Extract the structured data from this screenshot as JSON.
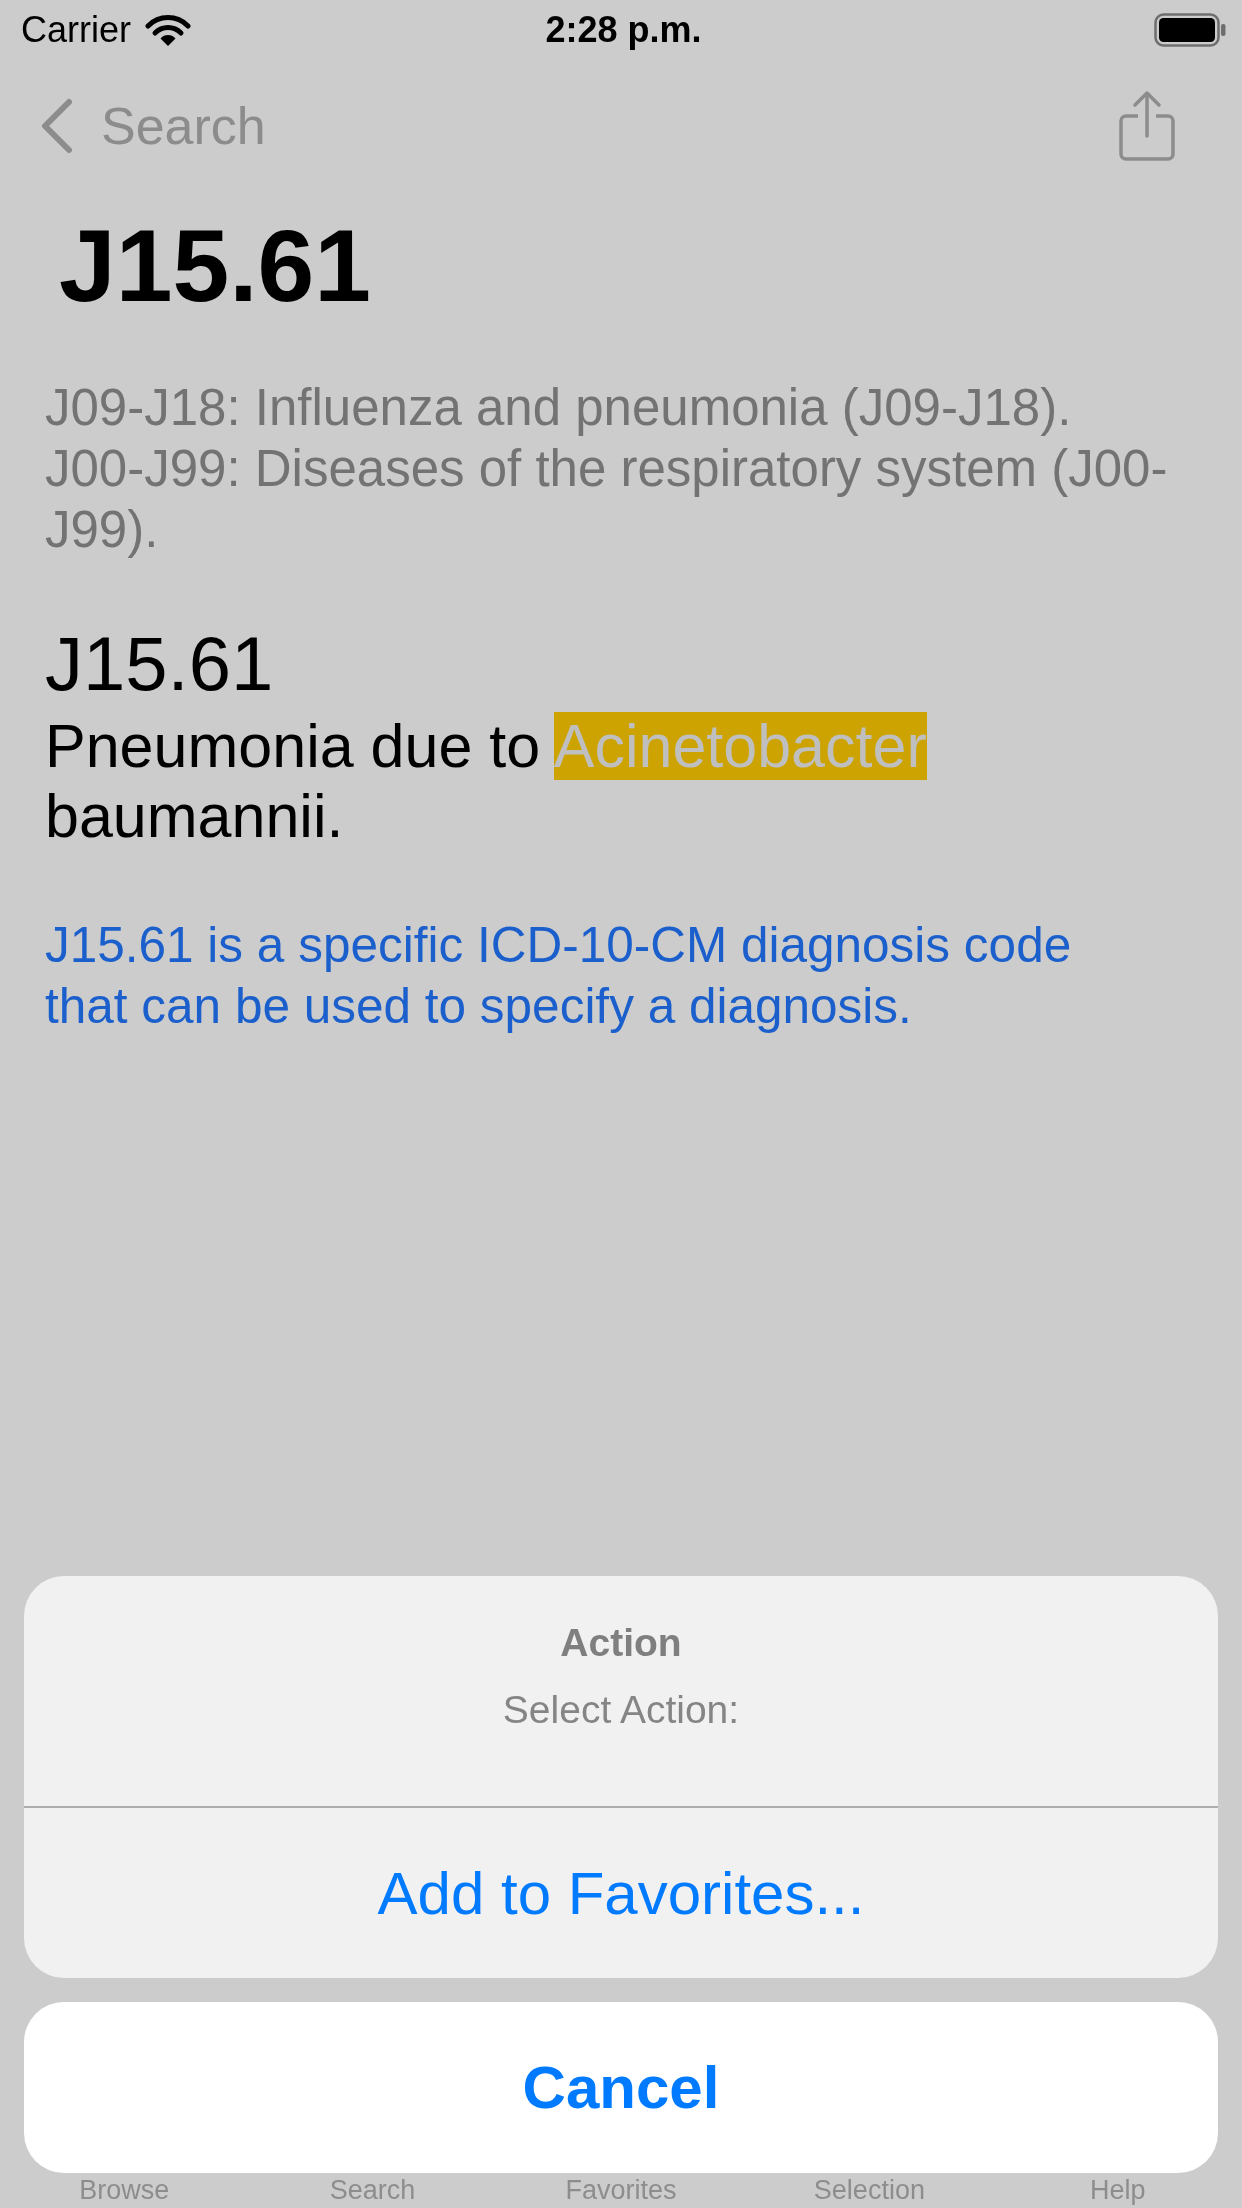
{
  "status_bar": {
    "carrier": "Carrier",
    "time": "2:28 p.m."
  },
  "nav_bar": {
    "back_label": "Search"
  },
  "header": {
    "title": "J15.61",
    "breadcrumbs": [
      "J09-J18: Influenza and pneumonia (J09-J18).",
      "J00-J99: Diseases of the respiratory system (J00-J99)."
    ]
  },
  "detail": {
    "code": "J15.61",
    "description": [
      {
        "text": "Pneumonia due to ",
        "highlighted": false
      },
      {
        "text": "Acinetobacter",
        "highlighted": true
      },
      {
        "text": " baumannii.",
        "highlighted": false
      }
    ],
    "note": "J15.61 is a specific ICD-10-CM diagnosis code that can be used to specify a diagnosis."
  },
  "tab_bar": {
    "items": [
      {
        "label": "Browse"
      },
      {
        "label": "Search"
      },
      {
        "label": "Favorites"
      },
      {
        "label": "Selection"
      },
      {
        "label": "Help"
      }
    ]
  },
  "action_sheet": {
    "title": "Action",
    "message": "Select Action:",
    "actions": [
      {
        "label": "Add to Favorites..."
      }
    ],
    "cancel": "Cancel"
  }
}
